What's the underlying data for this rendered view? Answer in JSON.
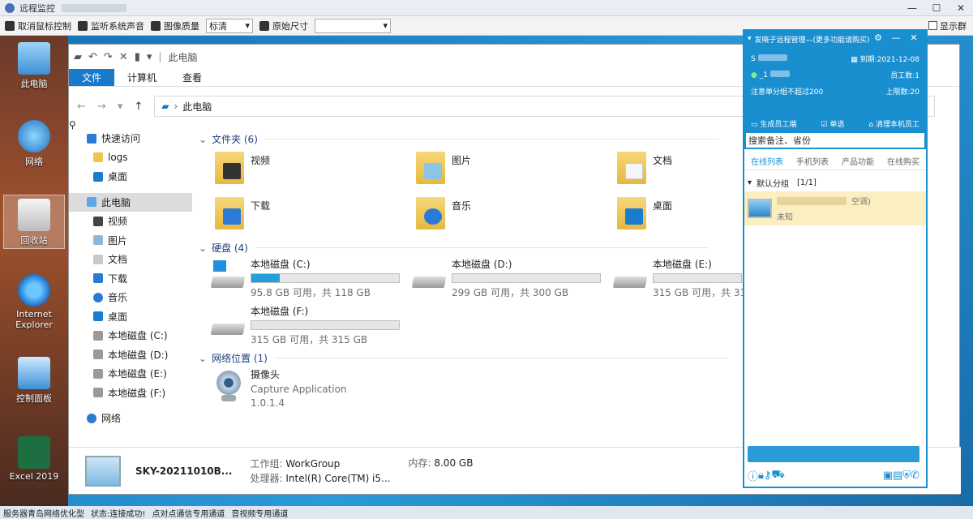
{
  "remote_window": {
    "title": "远程监控",
    "controls": {
      "minimize": "—",
      "maximize": "☐",
      "close": "✕"
    }
  },
  "toolbar": {
    "release_mouse": "取消鼠标控制",
    "monitor_sound": "监听系统声音",
    "image_quality_label": "图像质量",
    "image_quality_value": "标清",
    "original_size_label": "原始尺寸",
    "original_size_value": "",
    "show_tray": "显示群"
  },
  "desktop": {
    "icons": [
      {
        "label": "此电脑"
      },
      {
        "label": "网络"
      },
      {
        "label": "回收站"
      },
      {
        "label": "Internet Explorer"
      },
      {
        "label": "控制面板"
      },
      {
        "label": "Excel 2019"
      }
    ]
  },
  "explorer": {
    "title": "此电脑",
    "ribbon": {
      "file": "文件",
      "computer": "计算机",
      "view": "查看"
    },
    "address": "此电脑",
    "nav": [
      {
        "label": "快速访问"
      },
      {
        "label": "logs"
      },
      {
        "label": "桌面"
      },
      {
        "label": "此电脑"
      },
      {
        "label": "视频"
      },
      {
        "label": "图片"
      },
      {
        "label": "文档"
      },
      {
        "label": "下载"
      },
      {
        "label": "音乐"
      },
      {
        "label": "桌面"
      },
      {
        "label": "本地磁盘 (C:)"
      },
      {
        "label": "本地磁盘 (D:)"
      },
      {
        "label": "本地磁盘 (E:)"
      },
      {
        "label": "本地磁盘 (F:)"
      },
      {
        "label": "网络"
      }
    ],
    "sections": {
      "folders": "文件夹 (6)",
      "drives": "硬盘 (4)",
      "network": "网络位置 (1)"
    },
    "folders": [
      {
        "label": "视频"
      },
      {
        "label": "图片"
      },
      {
        "label": "文档"
      },
      {
        "label": "下载"
      },
      {
        "label": "音乐"
      },
      {
        "label": "桌面"
      }
    ],
    "drives": [
      {
        "label": "本地磁盘 (C:)",
        "space": "95.8 GB 可用，共 118 GB",
        "used_fraction": 0.19
      },
      {
        "label": "本地磁盘 (D:)",
        "space": "299 GB 可用，共 300 GB",
        "used_fraction": 0.0
      },
      {
        "label": "本地磁盘 (E:)",
        "space": "315 GB 可用，共 31",
        "used_fraction": 0.0
      },
      {
        "label": "本地磁盘 (F:)",
        "space": "315 GB 可用，共 315 GB",
        "used_fraction": 0.0
      }
    ],
    "network_item": {
      "name": "摄像头",
      "type": "Capture Application",
      "version": "1.0.1.4"
    },
    "details": {
      "computer_name": "SKY-20211010B...",
      "workgroup_label": "工作组:",
      "workgroup_value": "WorkGroup",
      "memory_label": "内存:",
      "memory_value": "8.00 GB",
      "cpu_label": "处理器:",
      "cpu_value": "Intel(R) Core(TM) i5..."
    }
  },
  "panel": {
    "title": "发晓子远程管理—(更多功能请购买)",
    "user_prefix": "S",
    "expire": "到期:2021-12-08",
    "id_prefix": "_1",
    "employees": "员工数:1",
    "note": "注意单分组不超过200",
    "limit": "上限数:20",
    "actions": [
      "生成员工端",
      "单选",
      "清理本机员工"
    ],
    "search": "搜索备注、省份",
    "tabs": [
      "在线列表",
      "手机列表",
      "产品功能",
      "在线购买"
    ],
    "group": "默认分组",
    "group_count": "[1/1]",
    "device_note": "空调)",
    "device_status": "未知"
  },
  "statusbar": {
    "items": [
      "服务器青岛网络优化型",
      "状态:连接成功!",
      "点对点通信专用通道",
      "音视频专用通道"
    ]
  },
  "colors": {
    "accent": "#1a8fd0",
    "ribbon_active": "#1979ca",
    "drive_bar": "#26a0da"
  }
}
